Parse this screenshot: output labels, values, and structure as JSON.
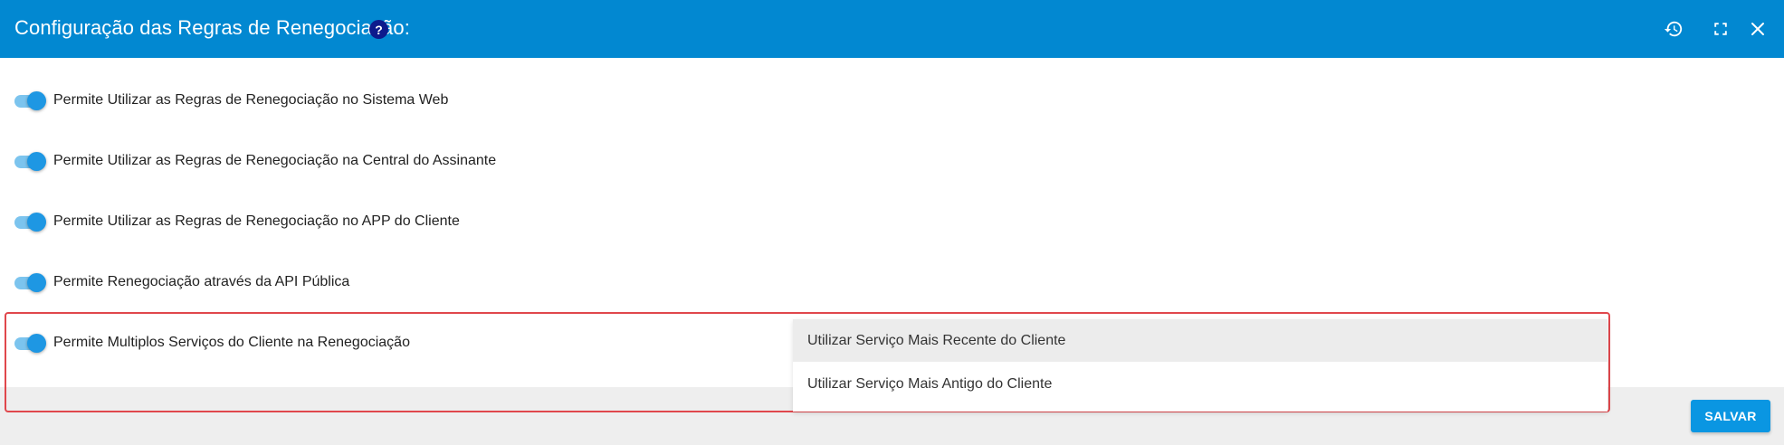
{
  "dialog": {
    "title": "Configuração das Regras de Renegociação:",
    "help_icon_glyph": "?",
    "header_color": "#0288d1",
    "icons": [
      "history-icon",
      "fullscreen-icon",
      "close-icon"
    ]
  },
  "settings": [
    {
      "label": "Permite Utilizar as Regras de Renegociação no Sistema Web",
      "enabled": true
    },
    {
      "label": "Permite Utilizar as Regras de Renegociação na Central do Assinante",
      "enabled": true
    },
    {
      "label": "Permite Utilizar as Regras de Renegociação no APP do Cliente",
      "enabled": true
    },
    {
      "label": "Permite Renegociação através da API Pública",
      "enabled": true
    },
    {
      "label": "Permite Multiplos Serviços do Cliente na Renegociação",
      "enabled": true
    }
  ],
  "service_select": {
    "options": [
      {
        "label": "Utilizar Serviço Mais Recente do Cliente",
        "selected": true
      },
      {
        "label": "Utilizar Serviço Mais Antigo do Cliente",
        "selected": false
      }
    ]
  },
  "footer": {
    "save_label": "SALVAR"
  },
  "colors": {
    "toggle_on_thumb": "#1e97e3",
    "toggle_on_track": "#7cc4ee",
    "highlight_border": "#e0474c",
    "save_button": "#0a96e2"
  }
}
